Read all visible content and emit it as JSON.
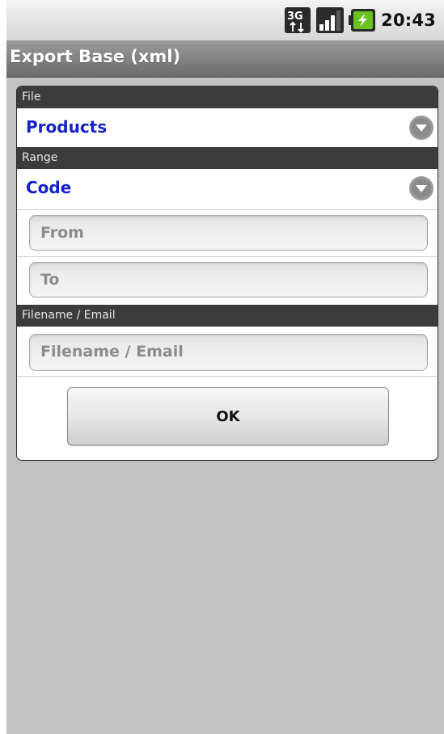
{
  "status_bar": {
    "time": "20:43",
    "icons": [
      "3g-data-icon",
      "signal-strength-icon",
      "battery-charging-icon"
    ]
  },
  "title_bar": {
    "title": "Export Base (xml)"
  },
  "form": {
    "file_section": {
      "header": "File",
      "selected": "Products"
    },
    "range_section": {
      "header": "Range",
      "selected": "Code",
      "from_placeholder": "From",
      "to_placeholder": "To"
    },
    "destination_section": {
      "header": "Filename / Email",
      "placeholder": "Filename / Email"
    },
    "ok_label": "OK"
  },
  "colors": {
    "spinner_text": "#1622c9",
    "section_header_bg": "#3c3c3c",
    "background": "#c2c2c2"
  }
}
